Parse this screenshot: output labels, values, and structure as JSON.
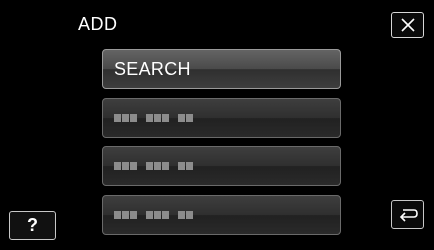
{
  "header": {
    "title": "ADD",
    "close_icon": "close-icon"
  },
  "menu": [
    {
      "label": "SEARCH",
      "placeholder": false
    },
    {
      "label": "",
      "placeholder": true,
      "groups": [
        3,
        3,
        2
      ]
    },
    {
      "label": "",
      "placeholder": true,
      "groups": [
        3,
        3,
        2
      ]
    },
    {
      "label": "",
      "placeholder": true,
      "groups": [
        3,
        3,
        2
      ]
    }
  ],
  "footer": {
    "help_label": "?",
    "back_icon": "return-arrow-icon"
  }
}
